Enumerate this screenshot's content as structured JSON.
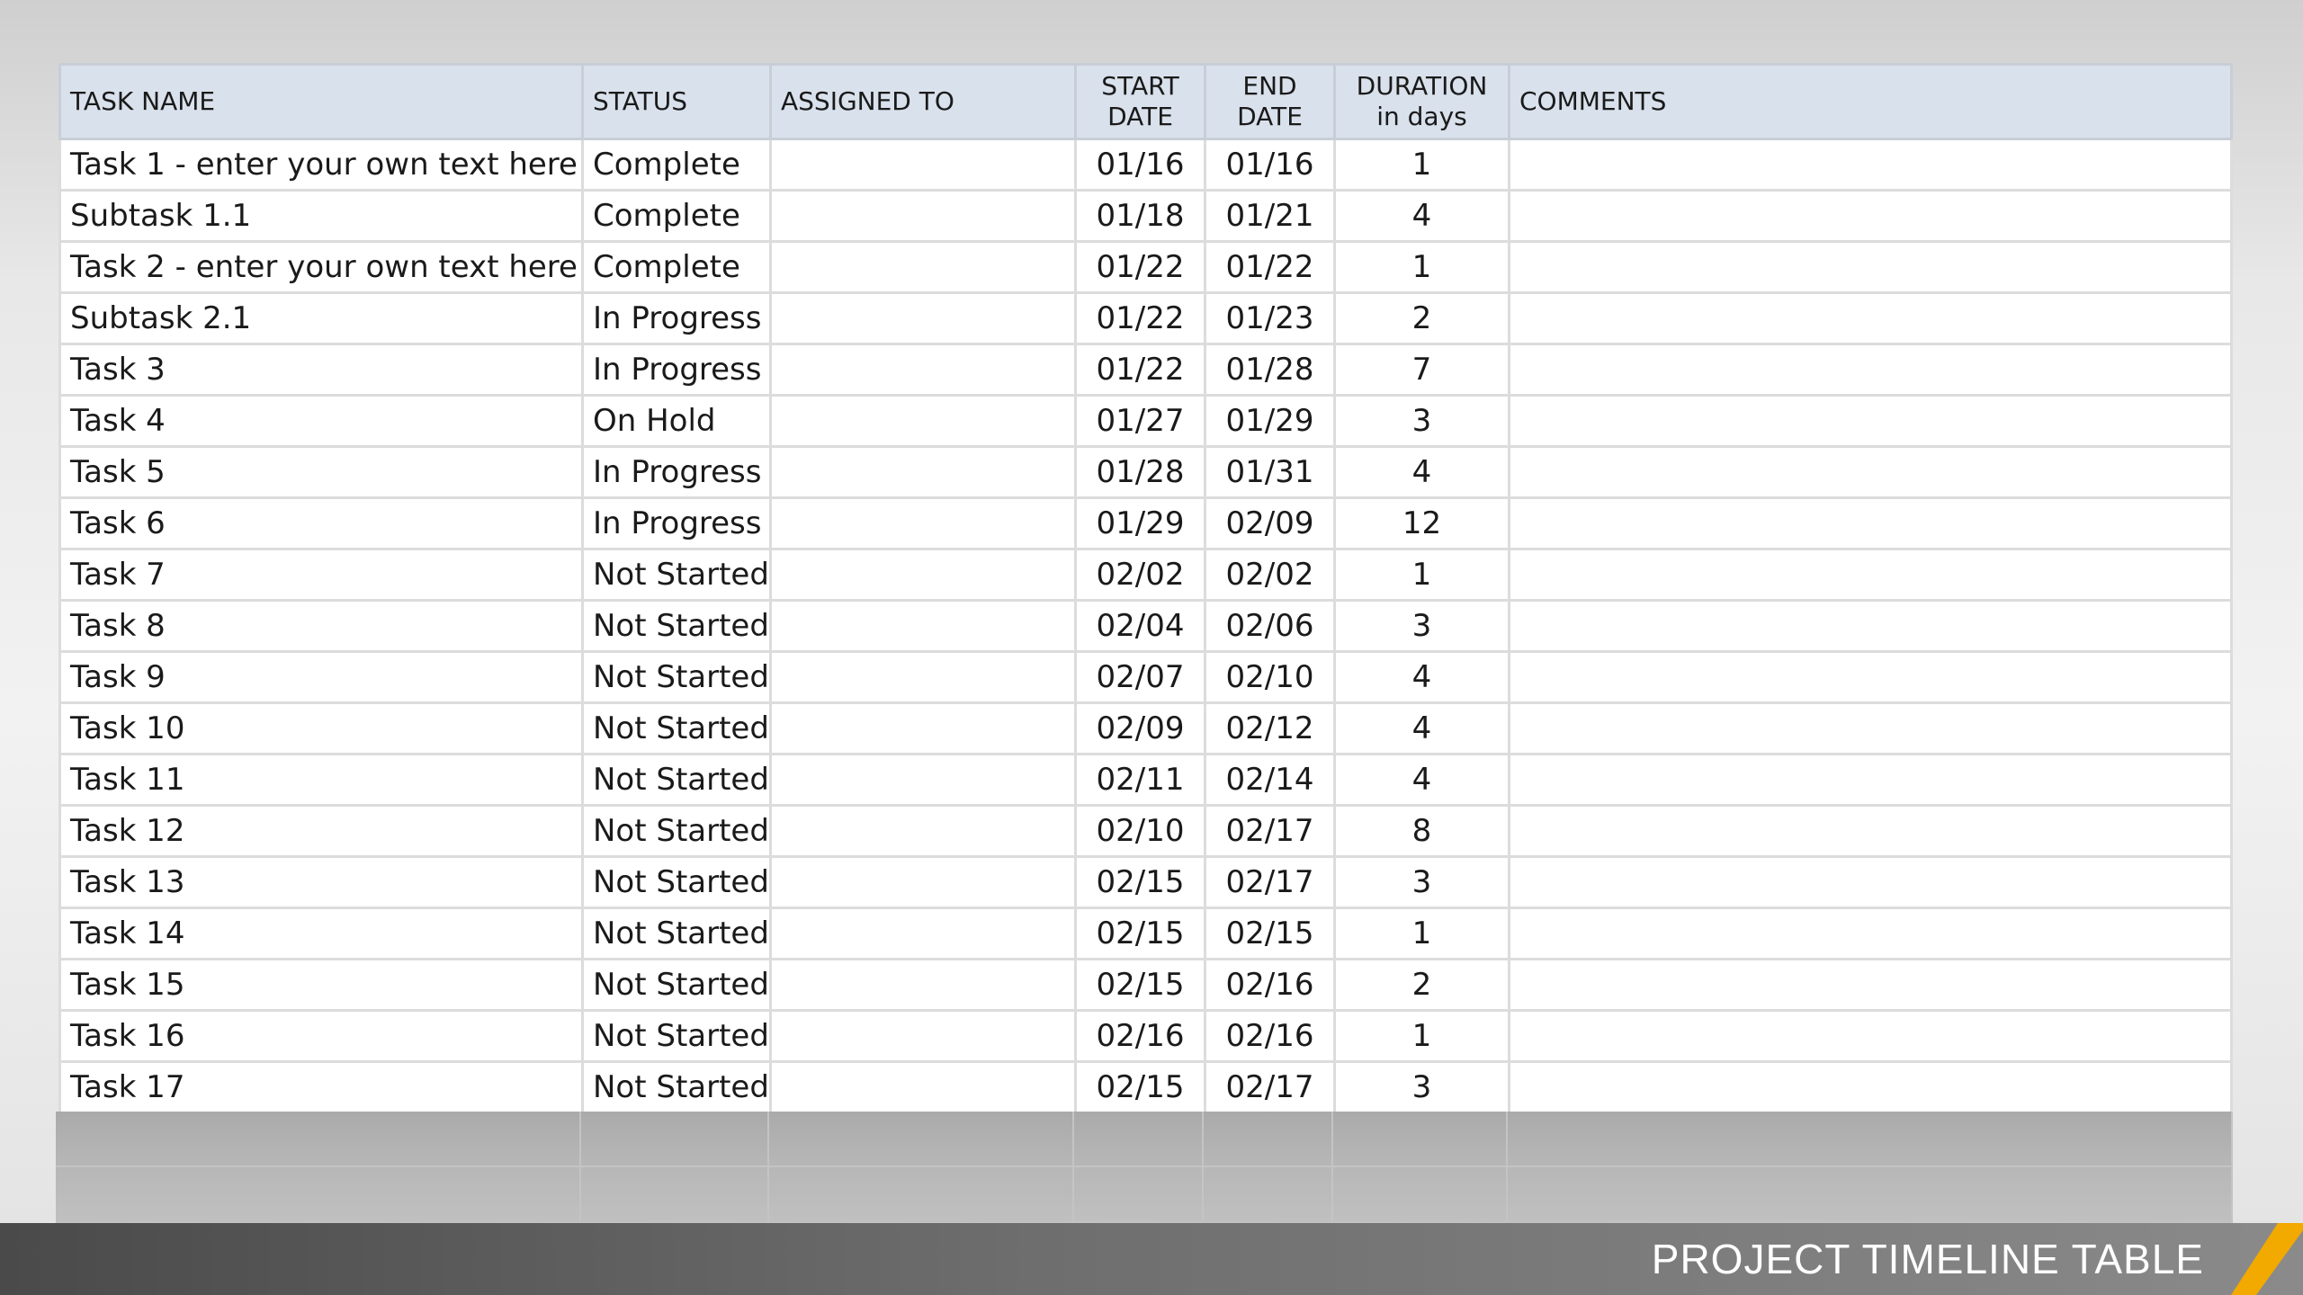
{
  "table": {
    "headers": {
      "task": "TASK NAME",
      "status": "STATUS",
      "assigned": "ASSIGNED TO",
      "start_line1": "START",
      "start_line2": "DATE",
      "end_line1": "END",
      "end_line2": "DATE",
      "duration_line1": "DURATION",
      "duration_line2": "in days",
      "comments": "COMMENTS"
    },
    "rows": [
      {
        "task": "Task 1 - enter your own text here",
        "status": "Complete",
        "assigned": "",
        "start": "01/16",
        "end": "01/16",
        "duration": "1",
        "comments": ""
      },
      {
        "task": "Subtask 1.1",
        "status": "Complete",
        "assigned": "",
        "start": "01/18",
        "end": "01/21",
        "duration": "4",
        "comments": ""
      },
      {
        "task": "Task 2 - enter your own text here",
        "status": "Complete",
        "assigned": "",
        "start": "01/22",
        "end": "01/22",
        "duration": "1",
        "comments": ""
      },
      {
        "task": "Subtask 2.1",
        "status": "In Progress",
        "assigned": "",
        "start": "01/22",
        "end": "01/23",
        "duration": "2",
        "comments": ""
      },
      {
        "task": "Task 3",
        "status": "In Progress",
        "assigned": "",
        "start": "01/22",
        "end": "01/28",
        "duration": "7",
        "comments": ""
      },
      {
        "task": "Task 4",
        "status": "On Hold",
        "assigned": "",
        "start": "01/27",
        "end": "01/29",
        "duration": "3",
        "comments": ""
      },
      {
        "task": "Task 5",
        "status": "In Progress",
        "assigned": "",
        "start": "01/28",
        "end": "01/31",
        "duration": "4",
        "comments": ""
      },
      {
        "task": "Task 6",
        "status": "In Progress",
        "assigned": "",
        "start": "01/29",
        "end": "02/09",
        "duration": "12",
        "comments": ""
      },
      {
        "task": "Task 7",
        "status": "Not Started",
        "assigned": "",
        "start": "02/02",
        "end": "02/02",
        "duration": "1",
        "comments": ""
      },
      {
        "task": "Task 8",
        "status": "Not Started",
        "assigned": "",
        "start": "02/04",
        "end": "02/06",
        "duration": "3",
        "comments": ""
      },
      {
        "task": "Task 9",
        "status": "Not Started",
        "assigned": "",
        "start": "02/07",
        "end": "02/10",
        "duration": "4",
        "comments": ""
      },
      {
        "task": "Task 10",
        "status": "Not Started",
        "assigned": "",
        "start": "02/09",
        "end": "02/12",
        "duration": "4",
        "comments": ""
      },
      {
        "task": "Task 11",
        "status": "Not Started",
        "assigned": "",
        "start": "02/11",
        "end": "02/14",
        "duration": "4",
        "comments": ""
      },
      {
        "task": "Task 12",
        "status": "Not Started",
        "assigned": "",
        "start": "02/10",
        "end": "02/17",
        "duration": "8",
        "comments": ""
      },
      {
        "task": "Task 13",
        "status": "Not Started",
        "assigned": "",
        "start": "02/15",
        "end": "02/17",
        "duration": "3",
        "comments": ""
      },
      {
        "task": "Task 14",
        "status": "Not Started",
        "assigned": "",
        "start": "02/15",
        "end": "02/15",
        "duration": "1",
        "comments": ""
      },
      {
        "task": "Task 15",
        "status": "Not Started",
        "assigned": "",
        "start": "02/15",
        "end": "02/16",
        "duration": "2",
        "comments": ""
      },
      {
        "task": "Task 16",
        "status": "Not Started",
        "assigned": "",
        "start": "02/16",
        "end": "02/16",
        "duration": "1",
        "comments": ""
      },
      {
        "task": "Task 17",
        "status": "Not Started",
        "assigned": "",
        "start": "02/15",
        "end": "02/17",
        "duration": "3",
        "comments": ""
      }
    ]
  },
  "footer": {
    "title": "PROJECT TIMELINE TABLE"
  },
  "colors": {
    "header_bg": "#d9e1ec",
    "accent_stripe": "#f2a900",
    "footer_bg": "#5a5a5a",
    "grid_line": "#dcdcdc"
  }
}
